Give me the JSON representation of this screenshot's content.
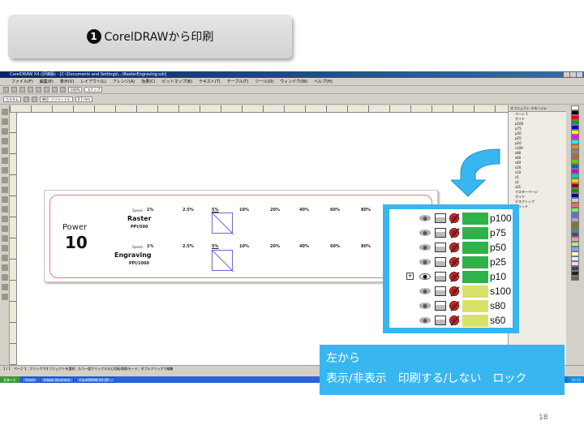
{
  "slide": {
    "step_number": "1",
    "title": "CorelDRAWから印刷",
    "page_number": "18"
  },
  "window": {
    "title": "CorelDRAW X4 (評価版) - [C:\\Documents and Settings\\...\\RasterEngraving.cdr]",
    "menu": [
      "ファイル(F)",
      "編集(E)",
      "表示(V)",
      "レイアウト(L)",
      "アレンジ(A)",
      "効果(C)",
      "ビットマップ(B)",
      "テキスト(T)",
      "テーブル(T)",
      "ツール(O)",
      "ウィンドウ(W)",
      "ヘルプ(H)"
    ],
    "zoom": "100%",
    "snap_label": "スナップ",
    "page_size_field": "カスタム",
    "unit_label": "単位: ミリメートル",
    "nudge_field": "0.1 mm",
    "status_text": "クリックでオブジェクトを選択、もう一度クリックすると回転/傾斜モード。ダブルクリックで編集",
    "page_tab": "ページ 1",
    "page_counter": "1 / 1",
    "taskbar": {
      "start": "スタート",
      "items": [
        "Gmail",
        "Adobe Illustrator",
        "CorelDRAW X4 (評..."
      ],
      "clock": "10:12"
    }
  },
  "docker": {
    "title": "オブジェクト マネージャ",
    "rows": [
      "ページ 1",
      "ガイド",
      "p100",
      "p75",
      "p50",
      "p25",
      "p10",
      "s100",
      "s80",
      "s60",
      "s40",
      "s20",
      "s10",
      "s5",
      "s2",
      "s01",
      "マスターページ",
      "ガイド",
      "デスクトップ",
      "グリッド"
    ]
  },
  "artwork": {
    "power_label": "Power",
    "power_value": "10",
    "speed_label": "Speed :",
    "speeds": [
      "1%",
      "2.5%",
      "5%",
      "10%",
      "20%",
      "40%",
      "60%",
      "80%"
    ],
    "raster": {
      "title": "Raster",
      "ppi": "PPI/500"
    },
    "engraving": {
      "title": "Engraving",
      "ppi": "PPI/1000"
    }
  },
  "zoom_layers": [
    {
      "name": "p100",
      "color": "#2fb24a",
      "expandable": false,
      "visible_eye": false
    },
    {
      "name": "p75",
      "color": "#2fb24a",
      "expandable": false,
      "visible_eye": false
    },
    {
      "name": "p50",
      "color": "#2fb24a",
      "expandable": false,
      "visible_eye": false
    },
    {
      "name": "p25",
      "color": "#2fb24a",
      "expandable": false,
      "visible_eye": false
    },
    {
      "name": "p10",
      "color": "#2fb24a",
      "expandable": true,
      "visible_eye": true
    },
    {
      "name": "s100",
      "color": "#d9e16a",
      "expandable": false,
      "visible_eye": false
    },
    {
      "name": "s80",
      "color": "#d9e16a",
      "expandable": false,
      "visible_eye": false
    },
    {
      "name": "s60",
      "color": "#d9e16a",
      "expandable": false,
      "visible_eye": false
    }
  ],
  "caption": {
    "line1": "左から",
    "line2": "表示/非表示　印刷する/しない　ロック"
  },
  "colors": {
    "accent": "#38b6ef",
    "layer_green": "#2fb24a",
    "layer_yellow": "#d9e16a"
  }
}
